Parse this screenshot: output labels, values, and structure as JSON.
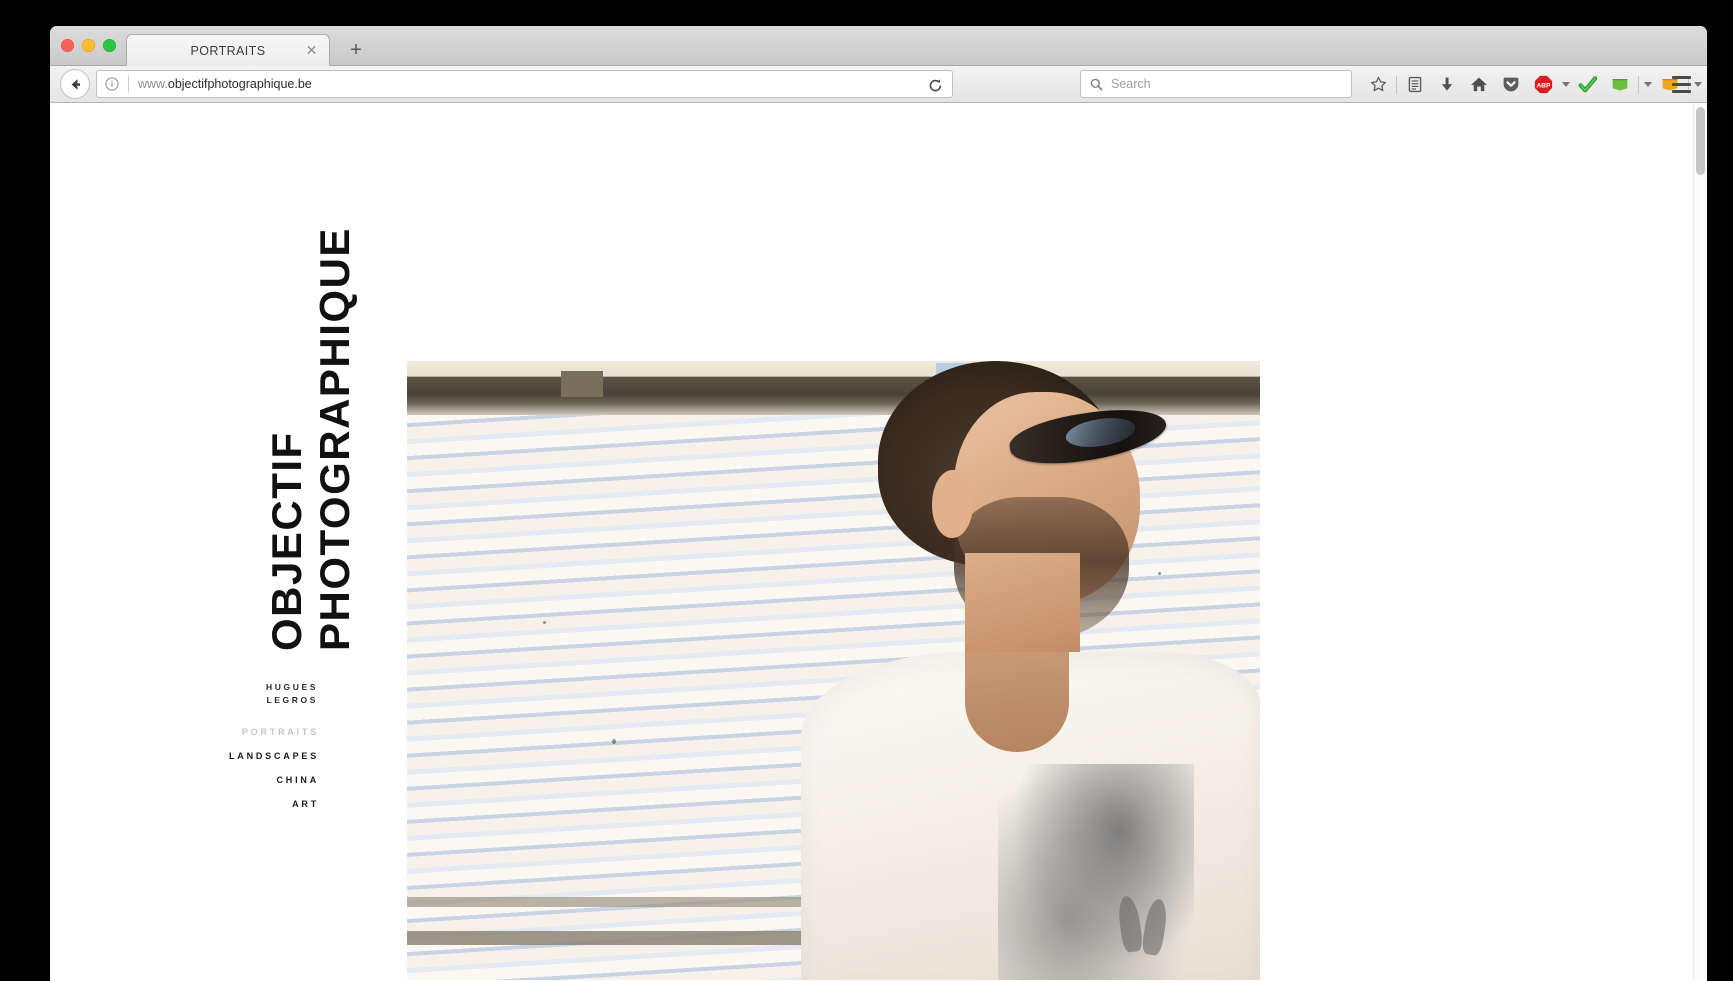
{
  "browser": {
    "traffic_lights": {
      "close_label": "close",
      "minimize_label": "minimize",
      "maximize_label": "maximize"
    },
    "tab": {
      "title": "PORTRAITS",
      "close_glyph": "✕"
    },
    "new_tab_glyph": "+",
    "url": {
      "scheme_prefix": "www.",
      "host": "objectifphotographique.be",
      "full": "www.objectifphotographique.be"
    },
    "search": {
      "placeholder": "Search",
      "icon": "search-icon"
    },
    "icons": [
      {
        "name": "bookmark-star-icon",
        "glyph": "☆"
      },
      {
        "name": "reader-list-icon",
        "glyph": "▤"
      },
      {
        "name": "downloads-icon",
        "glyph": "⬇"
      },
      {
        "name": "home-icon",
        "glyph": "⌂"
      },
      {
        "name": "pocket-icon",
        "glyph": "▼"
      },
      {
        "name": "adblock-plus-icon",
        "label": "ABP"
      },
      {
        "name": "checkmark-extension-icon",
        "glyph": "✔"
      },
      {
        "name": "green-book-extension-icon",
        "color": "#6cbf3f"
      },
      {
        "name": "orange-book-extension-icon",
        "color": "#f1a719"
      },
      {
        "name": "hamburger-menu-icon",
        "glyph": "☰"
      }
    ],
    "back_button": "back-icon",
    "reload_button": "reload-icon",
    "identity_icon": "info-icon",
    "scrollbar": {
      "name": "page-scrollbar",
      "position": "top"
    }
  },
  "site": {
    "title_line_1": "OBJECTIF",
    "title_line_2": "PHOTOGRAPHIQUE",
    "author_line_1": "HUGUES",
    "author_line_2": "LEGROS",
    "nav": [
      {
        "label": "PORTRAITS",
        "active": true,
        "name": "nav-portraits"
      },
      {
        "label": "LANDSCAPES",
        "active": false,
        "name": "nav-landscapes"
      },
      {
        "label": "CHINA",
        "active": false,
        "name": "nav-china"
      },
      {
        "label": "ART",
        "active": false,
        "name": "nav-art"
      }
    ],
    "hero_photo": {
      "name": "hero-photograph",
      "description": "Portrait of a bearded man wearing dark sunglasses and a white v-neck t-shirt with a graphite squirrel print, looking to his right in bright sunlight against a white and pale-blue striped corrugated metal wall."
    },
    "colors": {
      "page_background": "#ffffff",
      "title_text": "#111111",
      "nav_text": "#1a1a1a",
      "nav_active_text": "#c4c4c4"
    }
  }
}
